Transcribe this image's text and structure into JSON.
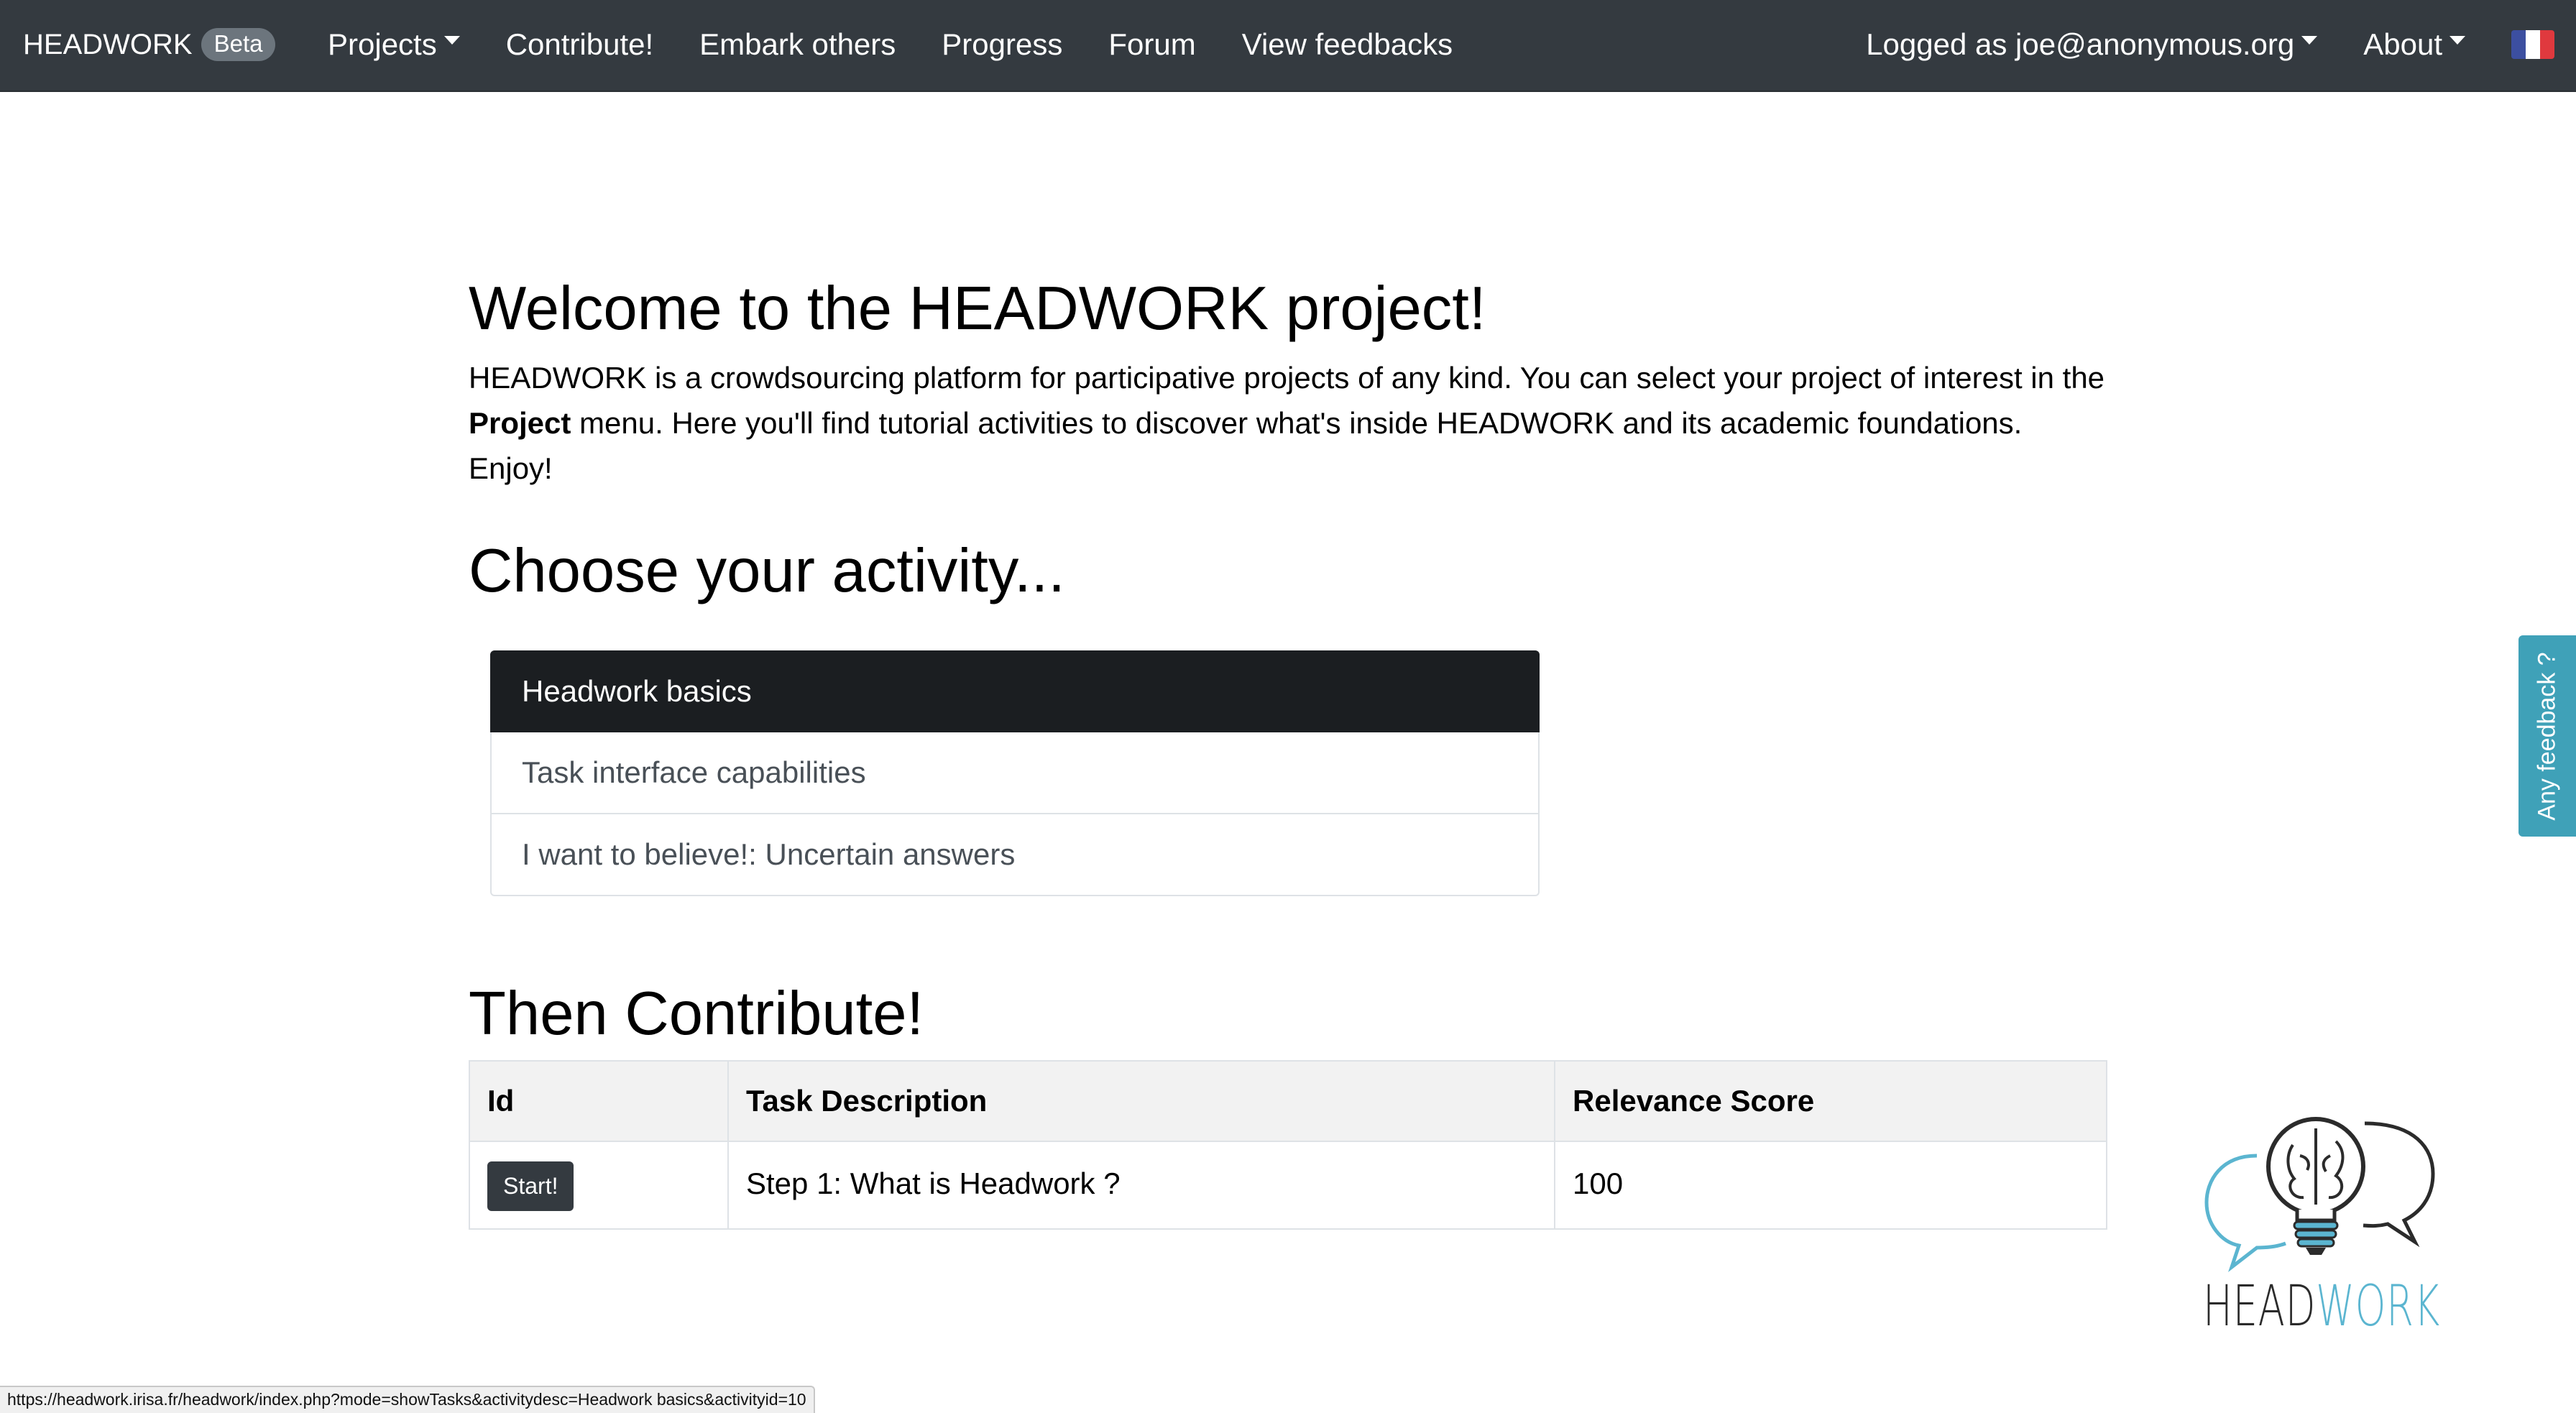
{
  "navbar": {
    "brand": "HEADWORK",
    "badge": "Beta",
    "left_items": [
      {
        "label": "Projects",
        "dropdown": true
      },
      {
        "label": "Contribute!",
        "dropdown": false
      },
      {
        "label": "Embark others",
        "dropdown": false
      },
      {
        "label": "Progress",
        "dropdown": false
      },
      {
        "label": "Forum",
        "dropdown": false
      },
      {
        "label": "View feedbacks",
        "dropdown": false
      }
    ],
    "right_items": [
      {
        "label": "Logged as joe@anonymous.org",
        "dropdown": true
      },
      {
        "label": "About",
        "dropdown": true
      }
    ],
    "language_flag": "flag-fr-icon",
    "colors": {
      "bg": "#343a40",
      "text": "#ffffff"
    }
  },
  "main": {
    "welcome_title": "Welcome to the HEADWORK project!",
    "intro": {
      "part1": "HEADWORK is a crowdsourcing platform for participative projects of any kind. You can select your project of interest in the ",
      "bold": "Project",
      "part2": " menu. Here you'll find tutorial activities to discover what's inside HEADWORK and its academic foundations. Enjoy!"
    },
    "choose_title": "Choose your activity...",
    "activities": [
      {
        "label": "Headwork basics",
        "active": true
      },
      {
        "label": "Task interface capabilities",
        "active": false
      },
      {
        "label": "I want to believe!: Uncertain answers",
        "active": false
      }
    ],
    "contribute_title": "Then Contribute!",
    "table": {
      "headers": [
        "Id",
        "Task Description",
        "Relevance Score"
      ],
      "rows": [
        {
          "action": "Start!",
          "description": "Step 1: What is Headwork ?",
          "score": "100"
        }
      ]
    }
  },
  "feedback_tab": "Any feedback ?",
  "logo": {
    "text_dark": "HEAD",
    "text_accent": "WORK",
    "accent_color": "#5bb5d0",
    "dark_color": "#2b2b2b"
  },
  "status_url": "https://headwork.irisa.fr/headwork/index.php?mode=showTasks&activitydesc=Headwork basics&activityid=10"
}
